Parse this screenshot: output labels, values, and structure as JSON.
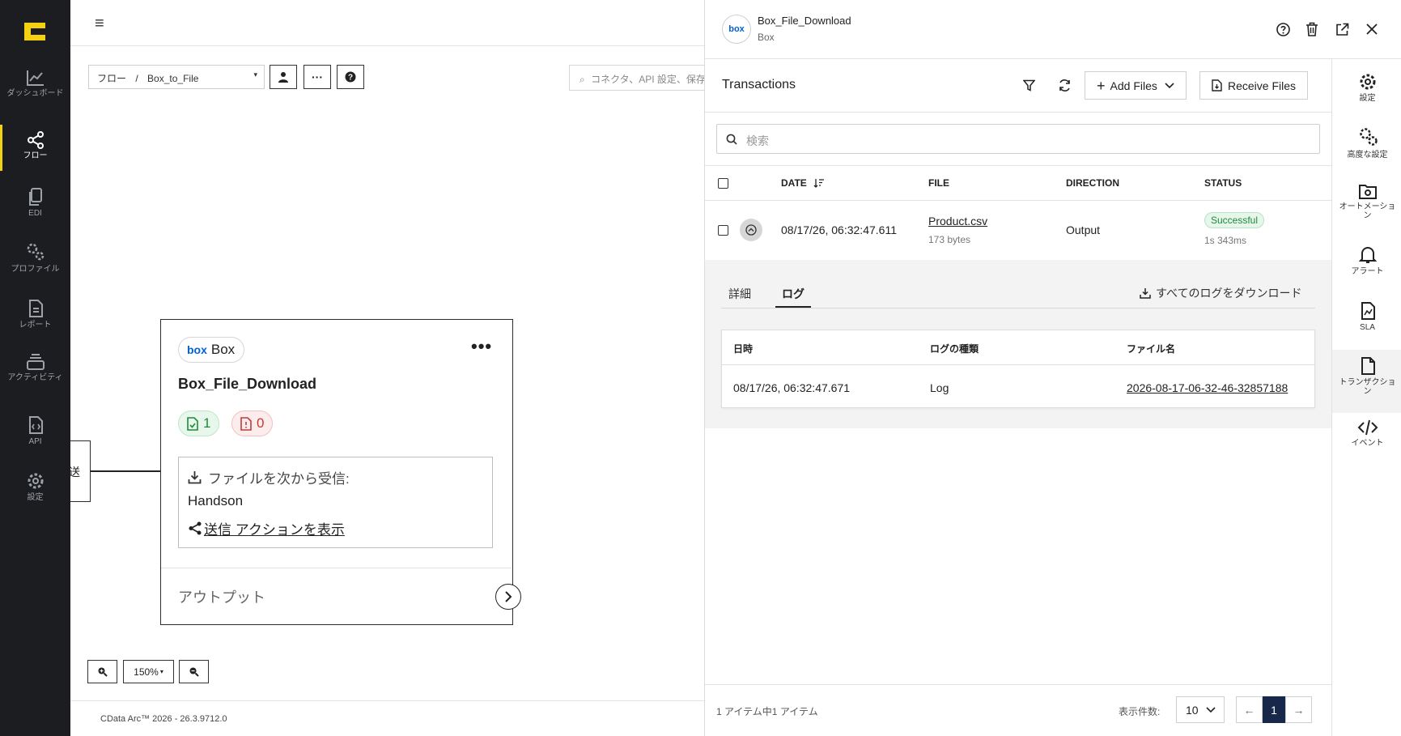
{
  "nav": {
    "items": [
      {
        "label": "ダッシュボード",
        "icon": "chart-line-icon"
      },
      {
        "label": "フロー",
        "icon": "flow-icon"
      },
      {
        "label": "EDI",
        "icon": "edi-icon"
      },
      {
        "label": "プロファイル",
        "icon": "gears-icon"
      },
      {
        "label": "レポート",
        "icon": "report-icon"
      },
      {
        "label": "アクティビティ",
        "icon": "activity-icon"
      },
      {
        "label": "API",
        "icon": "api-icon"
      },
      {
        "label": "設定",
        "icon": "gear-icon"
      }
    ],
    "active_index": 1,
    "accent": "#f5d211"
  },
  "canvas": {
    "breadcrumb_root": "フロー",
    "breadcrumb_sep": "/",
    "breadcrumb_current": "Box_to_File",
    "search_placeholder": "コネクタ、API 設定、保存",
    "node": {
      "badge_label": "Box",
      "badge_logo": "box",
      "title": "Box_File_Download",
      "success_count": "1",
      "error_count": "0",
      "receive_label": "ファイルを次から受信:",
      "receive_source": "Handson",
      "send_action_link": "送信 アクションを表示",
      "output_label": "アウトプット"
    },
    "left_node_char": "送",
    "zoom": "150%",
    "footer": "CData Arc™ 2026 - 26.3.9712.0"
  },
  "panel": {
    "title": "Box_File_Download",
    "subtitle": "Box",
    "logo_text": "box",
    "section_title": "Transactions",
    "add_files": "Add Files",
    "receive_files": "Receive Files",
    "search_placeholder": "検索",
    "columns": {
      "date": "DATE",
      "file": "FILE",
      "direction": "DIRECTION",
      "status": "STATUS"
    },
    "row": {
      "date": "08/17/26, 06:32:47.611",
      "file": "Product.csv",
      "size": "173 bytes",
      "direction": "Output",
      "status": "Successful",
      "duration": "1s 343ms"
    },
    "tabs": [
      "詳細",
      "ログ"
    ],
    "active_tab": 1,
    "download_logs": "すべてのログをダウンロード",
    "log_columns": {
      "datetime": "日時",
      "type": "ログの種類",
      "filename": "ファイル名"
    },
    "log_row": {
      "datetime": "08/17/26, 06:32:47.671",
      "type": "Log",
      "filename": "2026-08-17-06-32-46-32857188"
    },
    "footer_count": "1 アイテム中1 アイテム",
    "page_size_label": "表示件数:",
    "page_size": "10",
    "current_page": "1",
    "colors": {
      "success_bg": "#e6f6ea",
      "success_fg": "#1e8a3a",
      "page_active": "#17284a"
    }
  },
  "right_sidebar": {
    "items": [
      {
        "label": "設定",
        "icon": "gear-icon"
      },
      {
        "label": "高度な設定",
        "icon": "gears-icon"
      },
      {
        "label": "オートメーション",
        "icon": "automation-icon"
      },
      {
        "label": "アラート",
        "icon": "bell-icon"
      },
      {
        "label": "SLA",
        "icon": "sla-icon"
      },
      {
        "label": "トランザクション",
        "icon": "transaction-icon"
      },
      {
        "label": "イベント",
        "icon": "code-icon"
      }
    ],
    "active_index": 5
  }
}
